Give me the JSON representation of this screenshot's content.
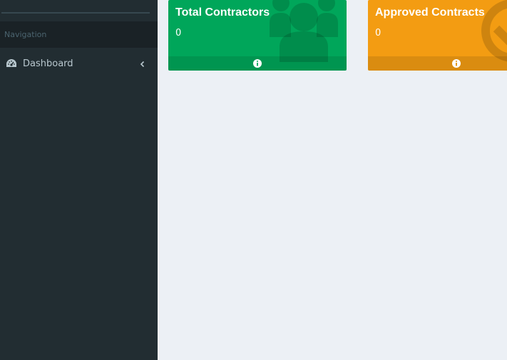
{
  "sidebar": {
    "nav_header": "Navigation",
    "items": [
      {
        "label": "Dashboard",
        "icon": "dashboard-icon",
        "expand_icon": "chevron-left-icon"
      }
    ]
  },
  "boxes": [
    {
      "title": "Total Contractors",
      "value": "0",
      "color": "#00a65a",
      "bg_icon": "users-icon",
      "footer_icon": "info-icon"
    },
    {
      "title": "Approved Contracts",
      "value": "0",
      "color": "#f39c12",
      "bg_icon": "check-circle-icon",
      "footer_icon": "info-icon"
    }
  ],
  "colors": {
    "sidebar_bg": "#222d32",
    "content_bg": "#ecf0f5",
    "nav_text": "#b8c7ce"
  }
}
